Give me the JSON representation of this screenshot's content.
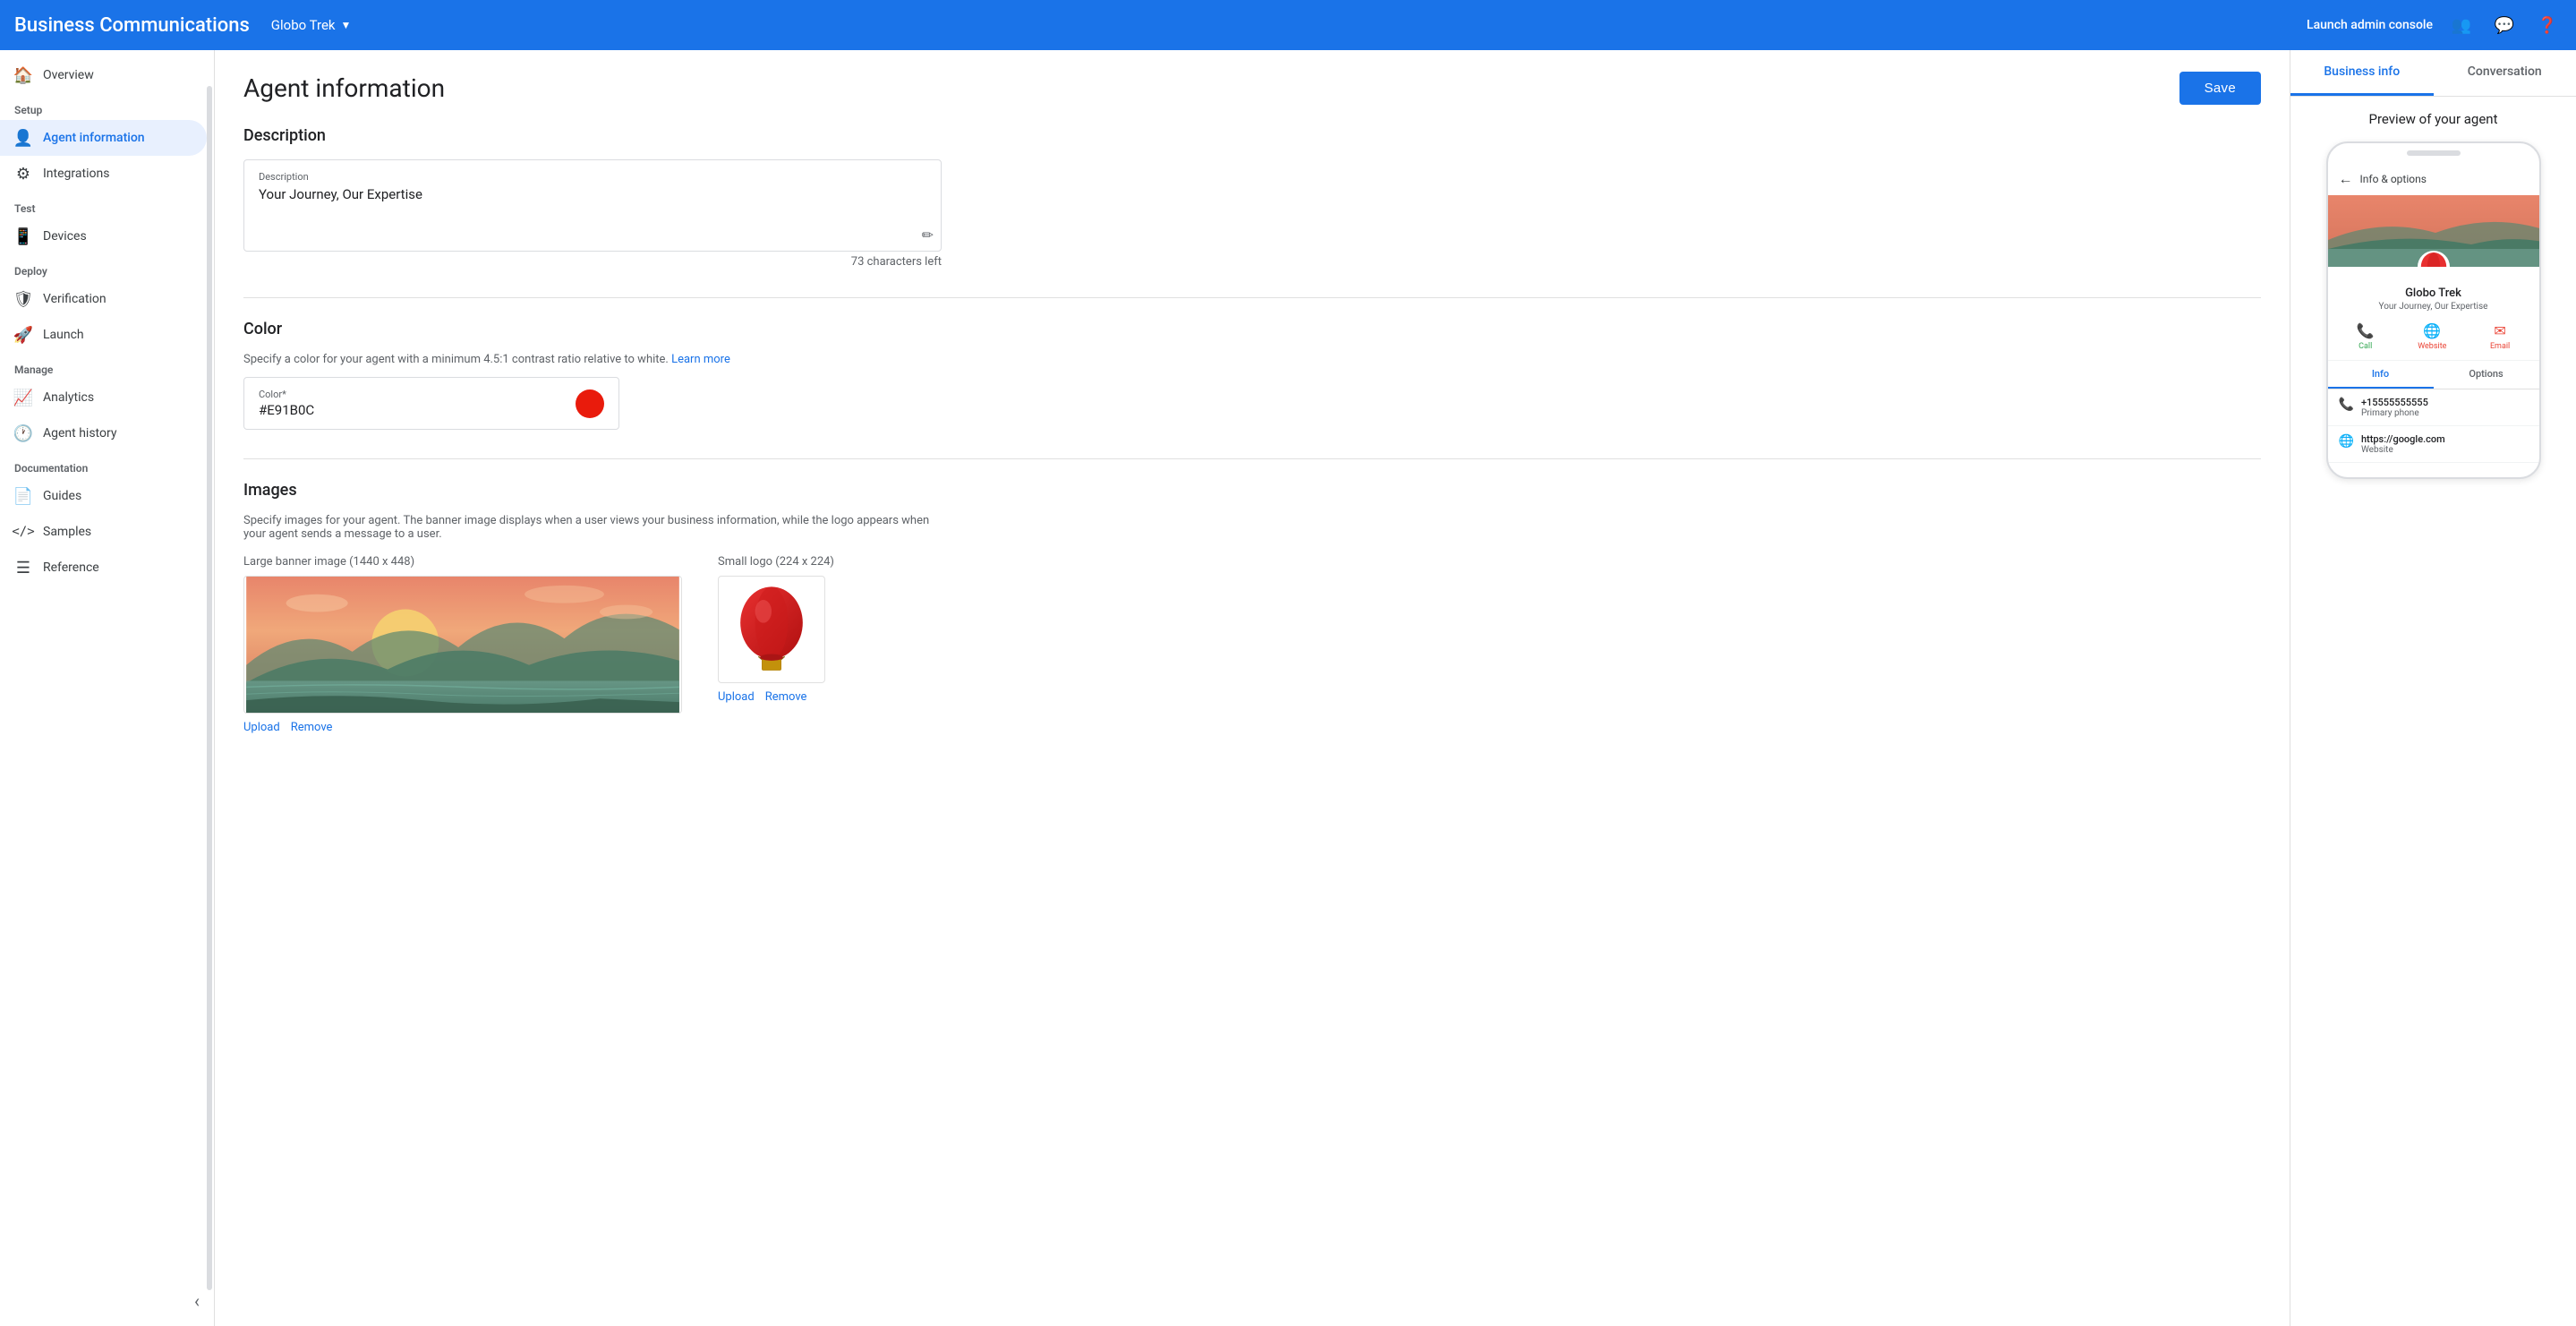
{
  "app": {
    "title": "Business Communications",
    "brand": "Globo Trek",
    "launch_label": "Launch admin console"
  },
  "sidebar": {
    "sections": [
      {
        "label": "",
        "items": [
          {
            "id": "overview",
            "label": "Overview",
            "icon": "🏠"
          }
        ]
      },
      {
        "label": "Setup",
        "items": [
          {
            "id": "agent-information",
            "label": "Agent information",
            "icon": "👤",
            "active": true
          },
          {
            "id": "integrations",
            "label": "Integrations",
            "icon": "⚙"
          }
        ]
      },
      {
        "label": "Test",
        "items": [
          {
            "id": "devices",
            "label": "Devices",
            "icon": "📱"
          }
        ]
      },
      {
        "label": "Deploy",
        "items": [
          {
            "id": "verification",
            "label": "Verification",
            "icon": "🛡"
          },
          {
            "id": "launch",
            "label": "Launch",
            "icon": "🚀"
          }
        ]
      },
      {
        "label": "Manage",
        "items": [
          {
            "id": "analytics",
            "label": "Analytics",
            "icon": "📈"
          },
          {
            "id": "agent-history",
            "label": "Agent history",
            "icon": "🕐"
          }
        ]
      },
      {
        "label": "Documentation",
        "items": [
          {
            "id": "guides",
            "label": "Guides",
            "icon": "📄"
          },
          {
            "id": "samples",
            "label": "Samples",
            "icon": "⟨⟩"
          },
          {
            "id": "reference",
            "label": "Reference",
            "icon": "≡"
          }
        ]
      }
    ]
  },
  "main": {
    "page_title": "Agent information",
    "save_label": "Save",
    "description": {
      "section_title": "Description",
      "field_label": "Description",
      "field_value": "Your Journey, Our Expertise",
      "char_count": "73 characters left"
    },
    "color": {
      "section_title": "Color",
      "subtitle": "Specify a color for your agent with a minimum 4.5:1 contrast ratio relative to white.",
      "learn_more": "Learn more",
      "field_label": "Color*",
      "field_value": "#E91B0C",
      "swatch_color": "#E91B0C"
    },
    "images": {
      "section_title": "Images",
      "subtitle": "Specify images for your agent. The banner image displays when a user views your business information, while the logo appears when your agent sends a message to a user.",
      "banner_label": "Large banner image (1440 x 448)",
      "logo_label": "Small logo (224 x 224)",
      "upload_label": "Upload",
      "remove_label": "Remove"
    }
  },
  "right_panel": {
    "tabs": [
      {
        "id": "business-info",
        "label": "Business info",
        "active": true
      },
      {
        "id": "conversation",
        "label": "Conversation",
        "active": false
      }
    ],
    "preview_label": "Preview of your agent",
    "phone": {
      "back_label": "Info & options",
      "agent_name": "Globo Trek",
      "agent_desc": "Your Journey, Our Expertise",
      "actions": [
        {
          "id": "call",
          "label": "Call",
          "color": "#34a853"
        },
        {
          "id": "website",
          "label": "Website",
          "color": "#ea4335"
        },
        {
          "id": "email",
          "label": "Email",
          "color": "#ea4335"
        }
      ],
      "info_tabs": [
        {
          "id": "info",
          "label": "Info",
          "active": true
        },
        {
          "id": "options",
          "label": "Options",
          "active": false
        }
      ],
      "info_rows": [
        {
          "icon": "📞",
          "value": "+15555555555",
          "label": "Primary phone"
        },
        {
          "icon": "🌐",
          "value": "https://google.com",
          "label": "Website"
        }
      ]
    }
  }
}
